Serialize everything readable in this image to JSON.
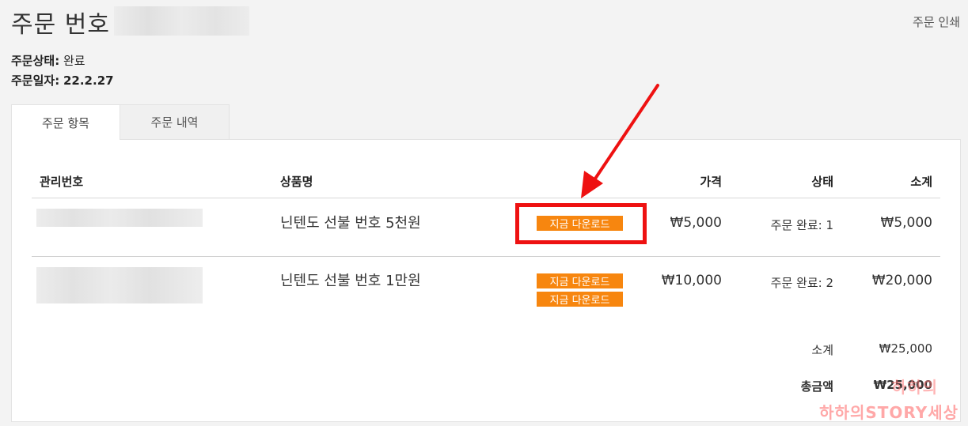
{
  "header": {
    "title": "주문 번호",
    "print_label": "주문 인쇄"
  },
  "meta": {
    "status_label": "주문상태:",
    "status_value": "완료",
    "date_label": "주문일자:",
    "date_value": "22.2.27"
  },
  "tabs": [
    {
      "label": "주문 항목",
      "active": true
    },
    {
      "label": "주문 내역",
      "active": false
    }
  ],
  "table": {
    "headers": [
      "관리번호",
      "상품명",
      "가격",
      "상태",
      "소계"
    ],
    "rows": [
      {
        "product": "닌텐도 선불 번호 5천원",
        "downloads": [
          "지금 다운로드"
        ],
        "price": "₩5,000",
        "status": "주문 완료: 1",
        "subtotal": "₩5,000"
      },
      {
        "product": "닌텐도 선불 번호 1만원",
        "downloads": [
          "지금 다운로드",
          "지금 다운로드"
        ],
        "price": "₩10,000",
        "status": "주문 완료: 2",
        "subtotal": "₩20,000"
      }
    ]
  },
  "summary": {
    "subtotal_label": "소계",
    "subtotal_value": "₩25,000",
    "total_label": "총금액",
    "total_value": "₩25,000"
  },
  "watermark": {
    "line1": "하하의",
    "line2": "하하의STORY세상"
  },
  "colors": {
    "download_button": "#f7860f",
    "highlight": "#ee1111"
  }
}
